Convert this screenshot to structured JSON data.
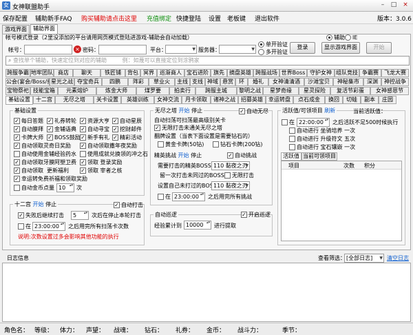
{
  "window": {
    "title": "女神联盟助手",
    "buttons": [
      "–",
      "□",
      "×"
    ]
  },
  "menu": {
    "items": [
      "保存配置",
      "辅助新手FAQ",
      "购买辅助请点击这里",
      "充值绑定",
      "快捷登陆",
      "设置",
      "老板键",
      "退出软件"
    ],
    "version": "版本：3.0.6",
    "colors": {
      "red": "#e00000",
      "green": "#109010"
    }
  },
  "top_tabs": [
    "游戏界面",
    "辅助界面"
  ],
  "login": {
    "hint": "帐号模式登录（2里没添加的平台请用网页模式登陆进游戏-辅助会自动加载）",
    "account_label": "帐号：",
    "password_label": "密码：",
    "platform_label": "平台：",
    "server_label": "服务器：",
    "mode_single": "单开验证",
    "mode_multi": "多开验证",
    "login_btn": "登录",
    "show_game_btn": "显示游戏界面",
    "start_btn": "开始",
    "assist_label": "辅助",
    "ie_label": "IE",
    "search_placeholder": "查找单个辅助，快速定位到对应的辅助",
    "clear_tip": "例：如蔑可以直接定位到涂鸦家",
    "error_icon": "×"
  },
  "func_tabs": [
    [
      "跨服争霸",
      "地牢团队",
      "商店",
      "聊天",
      "铁匠铺",
      "背包",
      "冥界",
      "巡渐商人",
      "宝石进阶",
      "旗先",
      "摘盘英雄",
      "跨服战场",
      "世界Boss",
      "守护女神",
      "组队竞技",
      "争霸赛",
      "飞龙大赛"
    ],
    [
      "公会(宴会/Boss/捐献)",
      "星光之战",
      "夺宝奇兵",
      "四鹏",
      "阵彩",
      "草业火",
      "主线",
      "支线",
      "神域",
      "悬赏",
      "环",
      "婚礼",
      "女神清清酒",
      "沙滩宝贝",
      "神秘集市",
      "深渊",
      "神控战争"
    ],
    [
      "宝物祭祀",
      "技能宝箱",
      "元素熔炉",
      "炼金大师",
      "煤罗要",
      "拍卖行",
      "跨服主城",
      "黎明之战",
      "星梦奇缘",
      "星灵探险",
      "复活节彩蛋",
      "女神感恩节"
    ],
    [
      "基础设置",
      "十二宫",
      "无尽之塔",
      "关卡设置",
      "英雄训练",
      "女神交流",
      "月卡领取",
      "诸神之战",
      "招募英雄",
      "幸运转盘",
      "点石成金",
      "换回",
      "切蛙",
      "副本",
      "庄园"
    ]
  ],
  "basic": {
    "title": "基础设置",
    "checks": [
      [
        "每日答题",
        "礼券转轮",
        "资源大亨",
        "自动星辰"
      ],
      [
        "自动膜拜",
        "金辅语典",
        "自动寻宝",
        "挖财邮件"
      ],
      [
        "卡牌大师",
        "BOSS鼓励",
        "新手有礼",
        "精彩活动"
      ],
      [
        "自动领取灵奇日奖励",
        "自动领取",
        "撒年夜奖励"
      ],
      [
        "自动使用金辅经验药水",
        "使用成就兑换领的冲之石"
      ],
      [
        "自动领取牙膜阿塑卫费",
        "领取 登录奖励"
      ],
      [
        "自动领取",
        "更新福利",
        "领取 宰者之核"
      ],
      [
        "幸运转免费祈福和领取奖励"
      ]
    ],
    "gold_label": "自动金币点量",
    "gold_value": "10",
    "gold_unit": "次"
  },
  "zodiac": {
    "title": "十二宫",
    "start": "开始",
    "stop": "停止",
    "auto_attack": "自动打击",
    "fail_label": "失败后继续打击",
    "fail_value": "5",
    "fail_unit": "次后在停止本轮打击",
    "time_label": "在",
    "time_value": "23:00:00",
    "time_suffix": "之后用完所有扫荡卡次数",
    "note": "说明:次数设置过多会影响其他功能的执行"
  },
  "tower": {
    "title": "无尽之塔",
    "start": "开始",
    "stop": "停止",
    "auto_none": "自动无尽",
    "q1": "自动扫荡可扫荡最高级别关卡",
    "q2": "无限打击未通关无尽之塔",
    "reset_label": "翻牌设置（当表下面设置是需要钻石的）",
    "gold_card": "黄金卡牌(50钻)",
    "diamond_card": "钻石卡牌(200钻)",
    "elite_title": "精英挑战",
    "elite_start": "开始",
    "elite_stop": "停止",
    "auto_challenge": "自动挑战",
    "need_label": "需要打击的精英BOSS",
    "need_value": "110 黏夜之刃",
    "left_label": "留一次打击未同过的BOSS",
    "unlimited": "无限打击",
    "set_label": "设置自己未打过的BOSS",
    "set_value": "110 黏夜之刃",
    "time_value": "23:00:00",
    "time_suffix": "之后用完所有挑战"
  },
  "patrol": {
    "title": "自动巡逻",
    "start_patrol": "开启巡逻",
    "exp_label": "经验累计到",
    "exp_value": "10000",
    "exp_suffix": "进行提取"
  },
  "activity": {
    "title": "活跃值/可领项目",
    "refresh": "刷新",
    "current": "当前活跃值：",
    "time_value": "22:00:00",
    "time_suffix": "之后活跃不足500时候执行",
    "items": [
      [
        "自动进行",
        "坐骑培养",
        "一次"
      ],
      [
        "自动进行",
        "升级符文",
        "五次"
      ],
      [
        "自动进行",
        "宝石镶嵌",
        "一次"
      ]
    ],
    "subtabs": [
      "活跃值",
      "当前可领项目"
    ],
    "headers": [
      "项目",
      "次数",
      "积分"
    ]
  },
  "log": {
    "title": "日志信息",
    "filter_label": "查看筛选：",
    "filter_value": "[全部日志]",
    "clear": "清空日志"
  },
  "status": {
    "fields": [
      "角色名：",
      "等级：",
      "体力：",
      "声望：",
      "战魂：",
      "钻石：",
      "礼券：",
      "金币：",
      "战斗力：",
      "季节："
    ]
  }
}
